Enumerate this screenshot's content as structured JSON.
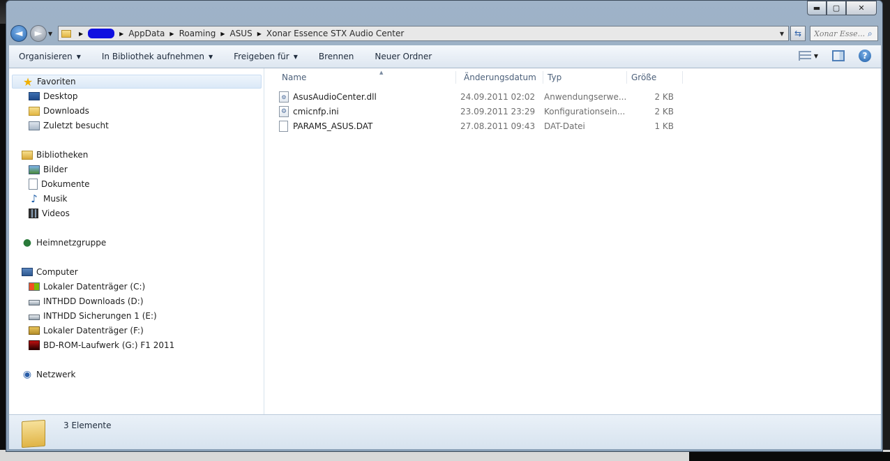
{
  "window": {
    "caption_buttons": {
      "minimize": "▬",
      "maximize": "▢",
      "close": "✕"
    }
  },
  "navigation": {
    "back_glyph": "◄",
    "forward_glyph": "►",
    "breadcrumb": [
      "AppData",
      "Roaming",
      "ASUS",
      "Xonar Essence STX Audio Center"
    ],
    "search_placeholder": "Xonar Esse..."
  },
  "commandbar": {
    "organize": "Organisieren",
    "include_library": "In Bibliothek aufnehmen",
    "share": "Freigeben für",
    "burn": "Brennen",
    "new_folder": "Neuer Ordner"
  },
  "navpane": {
    "favorites": {
      "header": "Favoriten",
      "items": [
        "Desktop",
        "Downloads",
        "Zuletzt besucht"
      ]
    },
    "libraries": {
      "header": "Bibliotheken",
      "items": [
        "Bilder",
        "Dokumente",
        "Musik",
        "Videos"
      ]
    },
    "homegroup": "Heimnetzgruppe",
    "computer": {
      "header": "Computer",
      "items": [
        "Lokaler Datenträger (C:)",
        "INTHDD Downloads (D:)",
        "INTHDD Sicherungen 1 (E:)",
        "Lokaler Datenträger (F:)",
        "BD-ROM-Laufwerk (G:) F1 2011"
      ]
    },
    "network": "Netzwerk"
  },
  "filelist": {
    "columns": [
      "Name",
      "Änderungsdatum",
      "Typ",
      "Größe"
    ],
    "rows": [
      {
        "name": "AsusAudioCenter.dll",
        "date": "24.09.2011 02:02",
        "type": "Anwendungserwe...",
        "size": "2 KB",
        "icon": "dll-file-icon"
      },
      {
        "name": "cmicnfp.ini",
        "date": "23.09.2011 23:29",
        "type": "Konfigurationsein...",
        "size": "2 KB",
        "icon": "ini-file-icon"
      },
      {
        "name": "PARAMS_ASUS.DAT",
        "date": "27.08.2011 09:43",
        "type": "DAT-Datei",
        "size": "1 KB",
        "icon": "dat-file-icon"
      }
    ]
  },
  "details": {
    "count_text": "3 Elemente"
  }
}
